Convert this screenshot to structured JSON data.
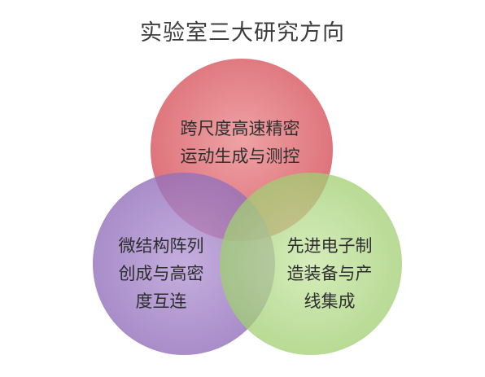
{
  "title": "实验室三大研究方向",
  "circles": [
    {
      "id": "top",
      "lines": [
        "跨尺度高速精密",
        "运动生成与测控"
      ],
      "color": "#e0767c"
    },
    {
      "id": "left",
      "lines": [
        "微结构阵列",
        "创成与高密",
        "度互连"
      ],
      "color": "#a586c8"
    },
    {
      "id": "right",
      "lines": [
        "先进电子制",
        "造装备与产",
        "线集成"
      ],
      "color": "#b6db8c"
    }
  ]
}
